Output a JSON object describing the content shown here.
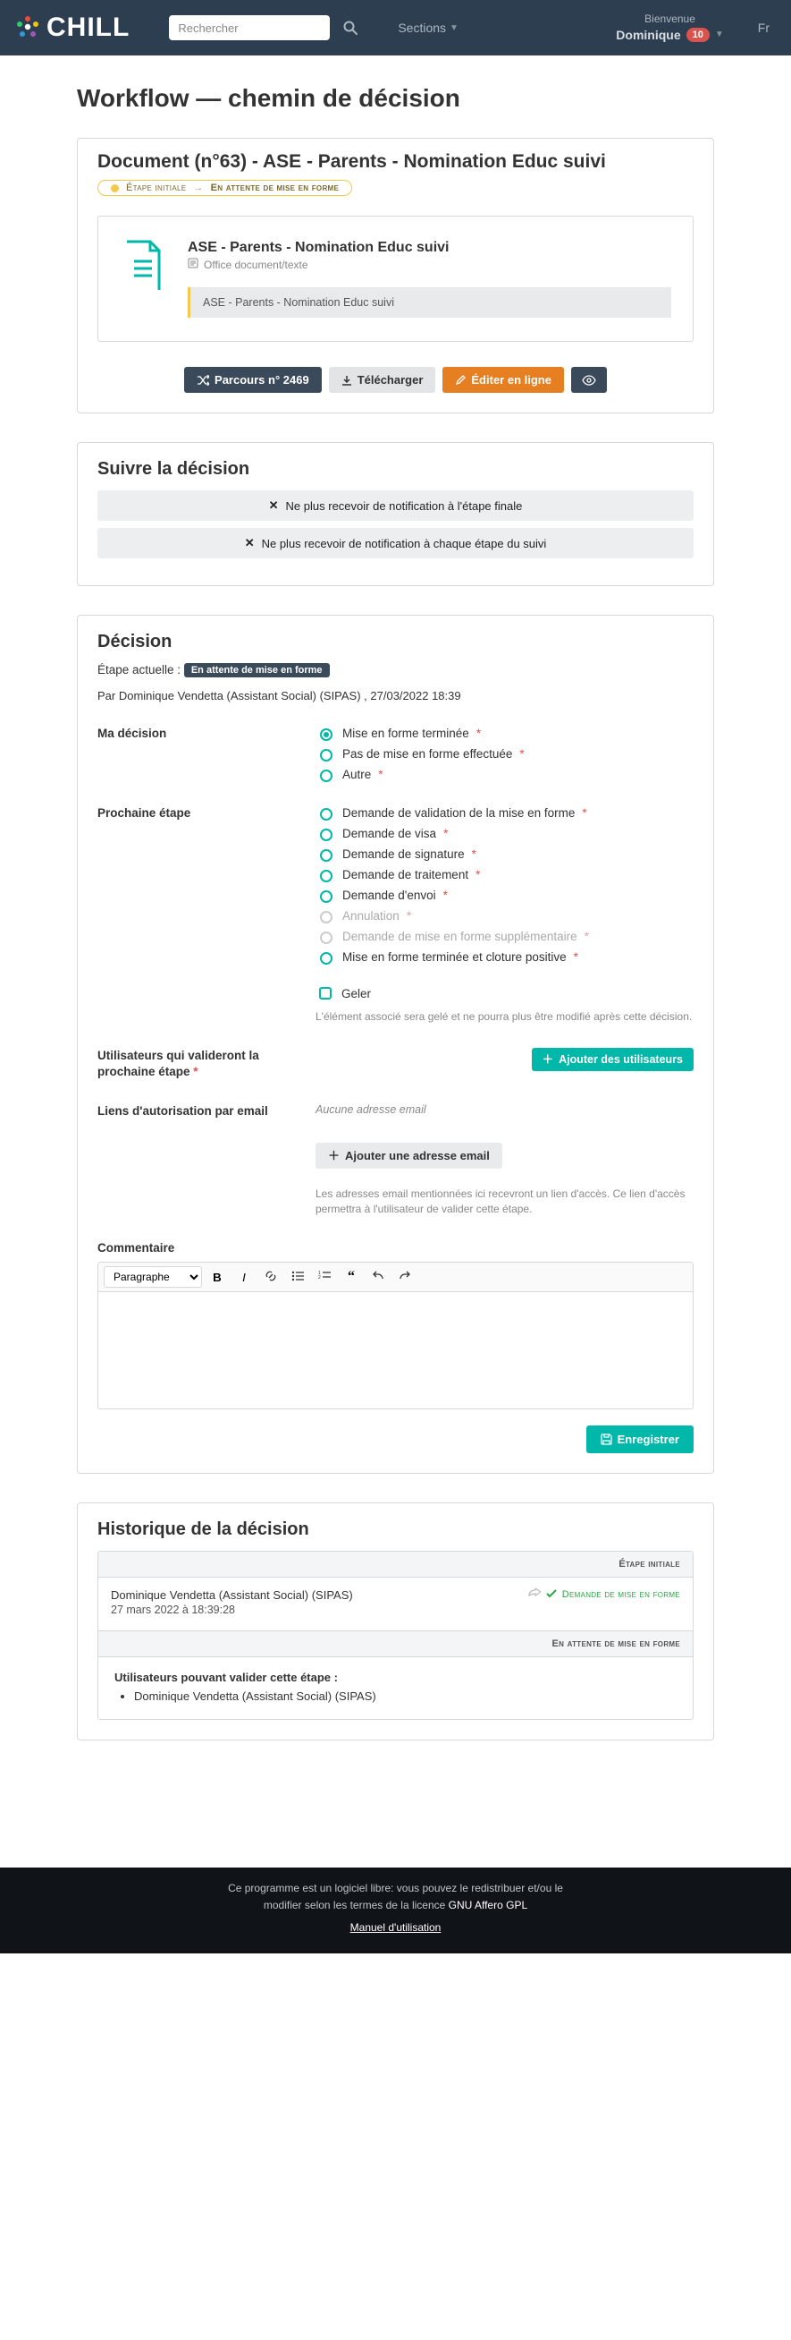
{
  "nav": {
    "logo_text": "CHILL",
    "search_placeholder": "Rechercher",
    "sections": "Sections",
    "welcome": "Bienvenue",
    "user_name": "Dominique",
    "user_badge": "10",
    "lang": "Fr"
  },
  "page": {
    "title": "Workflow — chemin de décision"
  },
  "document": {
    "heading": "Document (n°63) - ASE - Parents - Nomination Educ suivi",
    "step_initial": "Étape initiale",
    "step_current": "En attente de mise en forme",
    "name": "ASE - Parents - Nomination Educ suivi",
    "mime": "Office document/texte",
    "context": "ASE - Parents - Nomination Educ suivi",
    "btn_parcours": "Parcours n° 2469",
    "btn_download": "Télécharger",
    "btn_edit": "Éditer en ligne"
  },
  "follow": {
    "title": "Suivre la décision",
    "no_notif_final": "Ne plus recevoir de notification à l'étape finale",
    "no_notif_each": "Ne plus recevoir de notification à chaque étape du suivi"
  },
  "decision": {
    "title": "Décision",
    "current_label": "Étape actuelle :",
    "current_badge": "En attente de mise en forme",
    "by": "Par Dominique Vendetta (Assistant Social) (SIPAS) , 27/03/2022 18:39",
    "my_decision_label": "Ma décision",
    "my_decision_options": [
      {
        "label": "Mise en forme terminée",
        "required": true,
        "checked": true
      },
      {
        "label": "Pas de mise en forme effectuée",
        "required": true,
        "checked": false
      },
      {
        "label": "Autre",
        "required": true,
        "checked": false
      }
    ],
    "next_step_label": "Prochaine étape",
    "next_step_options": [
      {
        "label": "Demande de validation de la mise en forme",
        "required": true,
        "disabled": false
      },
      {
        "label": "Demande de visa",
        "required": true,
        "disabled": false
      },
      {
        "label": "Demande de signature",
        "required": true,
        "disabled": false
      },
      {
        "label": "Demande de traitement",
        "required": true,
        "disabled": false
      },
      {
        "label": "Demande d'envoi",
        "required": true,
        "disabled": false
      },
      {
        "label": "Annulation",
        "required": true,
        "disabled": true
      },
      {
        "label": "Demande de mise en forme supplémentaire",
        "required": true,
        "disabled": true
      },
      {
        "label": "Mise en forme terminée et cloture positive",
        "required": true,
        "disabled": false
      }
    ],
    "freeze_label": "Geler",
    "freeze_help": "L'élément associé sera gelé et ne pourra plus être modifié après cette décision.",
    "validators_label": "Utilisateurs qui valideront la prochaine étape",
    "add_users_btn": "Ajouter des utilisateurs",
    "email_label": "Liens d'autorisation par email",
    "no_email": "Aucune adresse email",
    "add_email_btn": "Ajouter une adresse email",
    "email_help": "Les adresses email mentionnées ici recevront un lien d'accès. Ce lien d'accès permettra à l'utilisateur de valider cette étape.",
    "comment_label": "Commentaire",
    "paragraph": "Paragraphe",
    "save_btn": "Enregistrer"
  },
  "history": {
    "title": "Historique de la décision",
    "initial_header": "Étape initiale",
    "user": "Dominique Vendetta (Assistant Social) (SIPAS)",
    "date": "27 mars 2022 à 18:39:28",
    "transition": "Demande de mise en forme",
    "pending_header": "En attente de mise en forme",
    "validators_label": "Utilisateurs pouvant valider cette étape :",
    "validators": [
      "Dominique Vendetta (Assistant Social) (SIPAS)"
    ]
  },
  "footer": {
    "line1": "Ce programme est un logiciel libre: vous pouvez le redistribuer et/ou le",
    "line2_prefix": "modifier selon les termes de la licence ",
    "license": "GNU Affero GPL",
    "manual": "Manuel d'utilisation"
  }
}
